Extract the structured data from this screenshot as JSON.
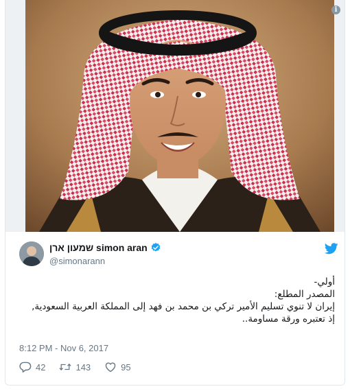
{
  "tweet": {
    "author_name": "שמעון ארן simon aran",
    "author_handle": "@simonarann",
    "text_lines": [
      "أولي-",
      "المصدر المطلع:",
      "إيران لا تنوي تسليم الأمير تركي بن محمد بن فهد إلى المملكة العربية السعودية,",
      "إذ تعتبره ورقة مساومة.."
    ],
    "timestamp": "8:12 PM - Nov 6, 2017",
    "reply_count": "42",
    "retweet_count": "143",
    "like_count": "95"
  },
  "icons": {
    "info": "info-icon",
    "verified": "verified-badge-icon",
    "brand": "twitter-bird-icon",
    "reply": "reply-icon",
    "retweet": "retweet-icon",
    "like": "heart-icon"
  },
  "colors": {
    "twitter_blue": "#1da1f2",
    "muted_text": "#657786",
    "primary_text": "#14171a",
    "border": "#e1e8ed"
  }
}
